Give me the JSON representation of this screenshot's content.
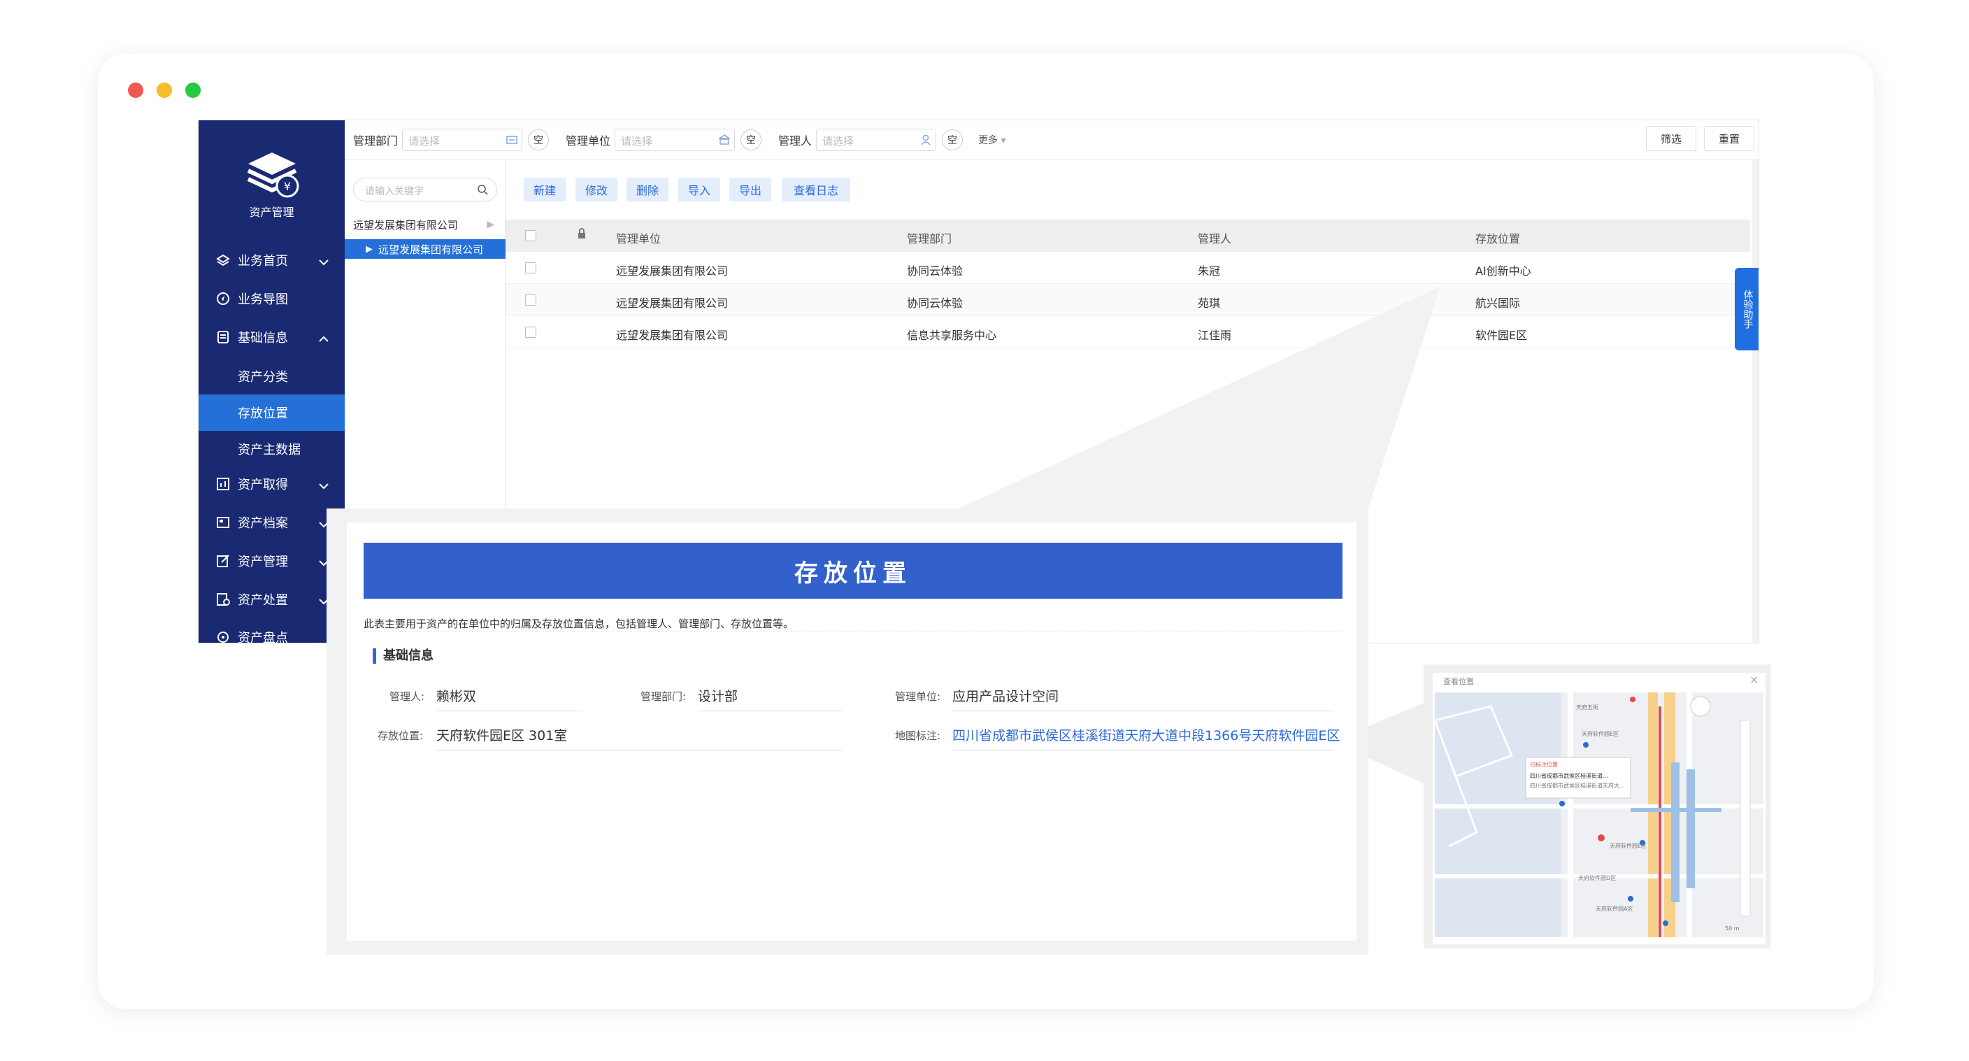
{
  "app": {
    "logo_text": "资产管理",
    "sidebar": {
      "items": [
        {
          "label": "业务首页"
        },
        {
          "label": "业务导图"
        },
        {
          "label": "基础信息"
        },
        {
          "label": "资产分类"
        },
        {
          "label": "存放位置"
        },
        {
          "label": "资产主数据"
        },
        {
          "label": "资产取得"
        },
        {
          "label": "资产档案"
        },
        {
          "label": "资产管理"
        },
        {
          "label": "资产处置"
        },
        {
          "label": "资产盘点"
        }
      ]
    },
    "filters": {
      "dept_label": "管理部门",
      "dept_placeholder": "请选择",
      "unit_label": "管理单位",
      "unit_placeholder": "请选择",
      "manager_label": "管理人",
      "manager_placeholder": "请选择",
      "clear_label": "空",
      "more_label": "更多",
      "filter_button": "筛选",
      "reset_button": "重置",
      "expand_icon": "»"
    },
    "tree": {
      "search_placeholder": "请输入关键字",
      "nodes": [
        {
          "label": "远望发展集团有限公司"
        },
        {
          "label": "远望发展集团有限公司"
        }
      ]
    },
    "toolbar": {
      "new": "新建",
      "edit": "修改",
      "delete": "删除",
      "import": "导入",
      "export": "导出",
      "log": "查看日志"
    },
    "table": {
      "headers": [
        "管理单位",
        "管理部门",
        "管理人",
        "存放位置"
      ],
      "rows": [
        [
          "远望发展集团有限公司",
          "协同云体验",
          "朱冠",
          "AI创新中心"
        ],
        [
          "远望发展集团有限公司",
          "协同云体验",
          "苑琪",
          "航兴国际"
        ],
        [
          "远望发展集团有限公司",
          "信息共享服务中心",
          "江佳雨",
          "软件园E区"
        ]
      ]
    },
    "helper_tab": "体验助手"
  },
  "detail": {
    "title": "存放位置",
    "description": "此表主要用于资产的在单位中的归属及存放位置信息，包括管理人、管理部门、存放位置等。",
    "section_title": "基础信息",
    "fields": {
      "manager_label": "管理人:",
      "manager_value": "赖彬双",
      "dept_label": "管理部门:",
      "dept_value": "设计部",
      "unit_label": "管理单位:",
      "unit_value": "应用产品设计空间",
      "location_label": "存放位置:",
      "location_value": "天府软件园E区 301室",
      "map_label": "地图标注:",
      "map_value": "四川省成都市武侯区桂溪街道天府大道中段1366号天府软件园E区"
    }
  },
  "map_popup": {
    "title": "查看位置",
    "close_icon": "×",
    "info_title": "已标注位置",
    "info_line1": "四川省成都市武侯区桂溪街道...",
    "info_line2": "四川省成都市武侯区桂溪街道天府大...",
    "labels": {
      "poi_top": "天府五街",
      "poi_park": "天府软件园E区",
      "poi_mid": "天府软件园E区",
      "poi_bottom": "天府软件园A区",
      "poi_d": "天府软件园D区",
      "scale": "50 m"
    }
  },
  "colors": {
    "sidebar_bg": "#1a2a72",
    "accent": "#2470d8",
    "title_bar": "#3361cc"
  }
}
